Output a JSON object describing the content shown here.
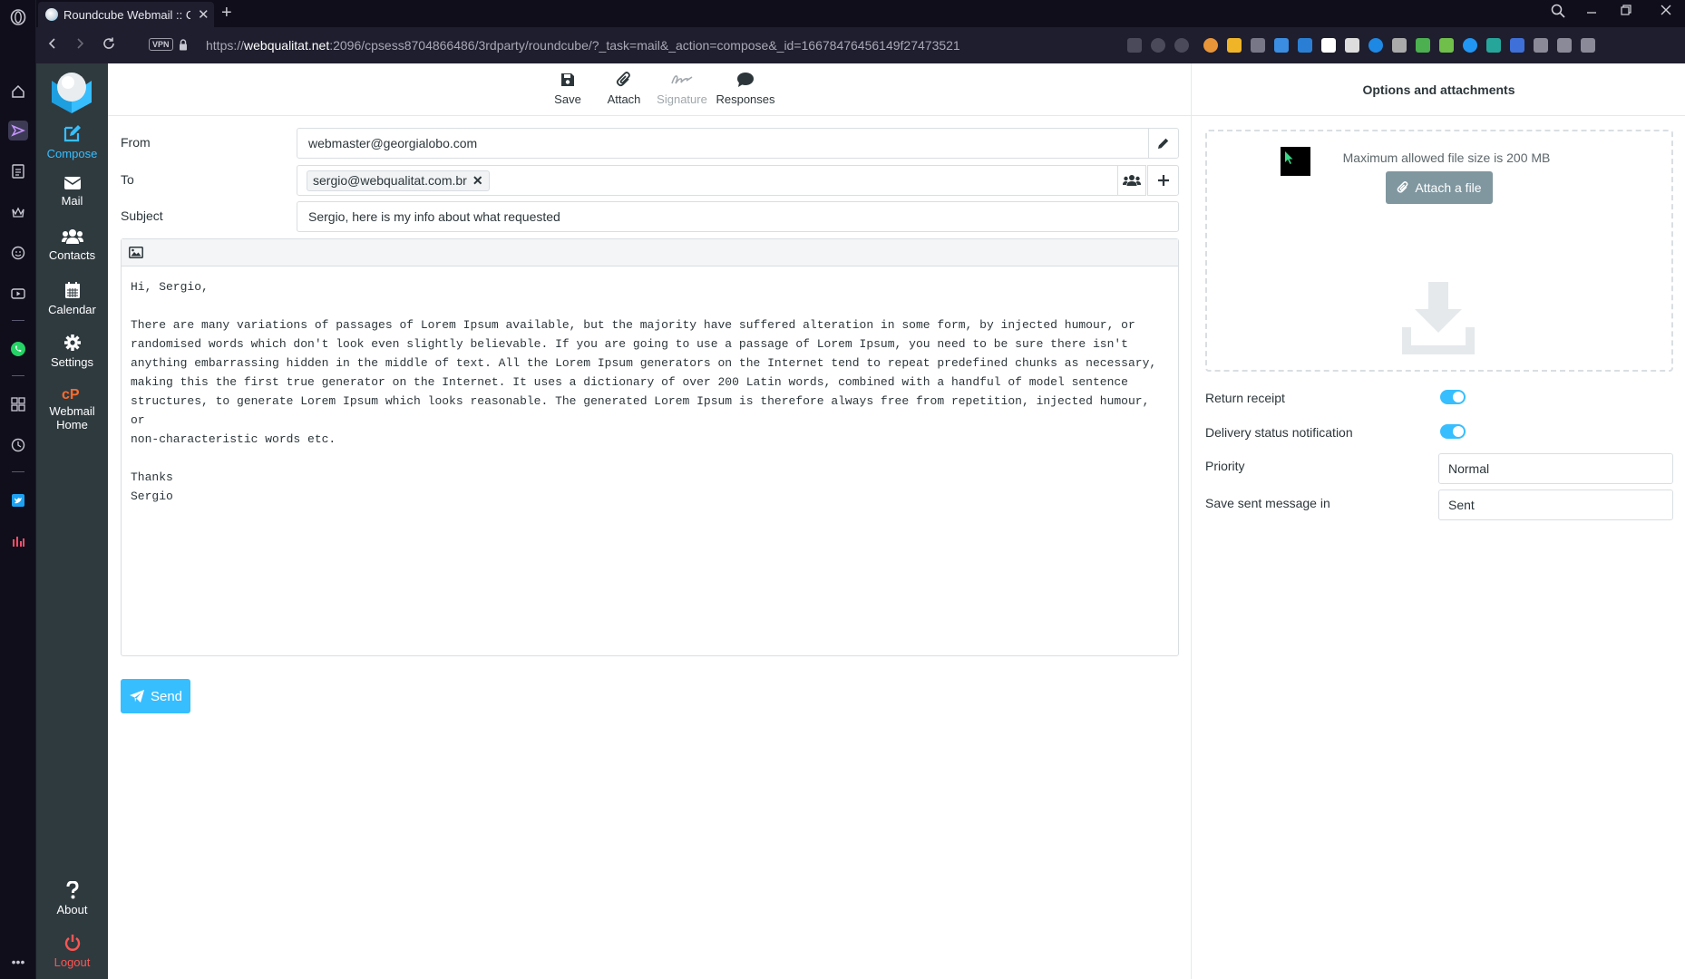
{
  "browser": {
    "tab_title": "Roundcube Webmail :: Compose",
    "tab_close": "✕",
    "new_tab": "+",
    "vpn_badge": "VPN",
    "url_prefix": "https://",
    "url_host": "webqualitat.net",
    "url_rest": ":2096/cpsess8704866486/3rdparty/roundcube/?_task=mail&_action=compose&_id=16678476456149f27473521"
  },
  "nav": {
    "compose": "Compose",
    "mail": "Mail",
    "contacts": "Contacts",
    "calendar": "Calendar",
    "settings": "Settings",
    "webmail_home_1": "Webmail",
    "webmail_home_2": "Home",
    "about": "About",
    "logout": "Logout"
  },
  "toolbar": {
    "save": "Save",
    "attach": "Attach",
    "signature": "Signature",
    "responses": "Responses"
  },
  "compose": {
    "from_label": "From",
    "from_value": "webmaster@georgialobo.com",
    "to_label": "To",
    "to_recipient": "sergio@webqualitat.com.br",
    "subject_label": "Subject",
    "subject_value": "Sergio, here is my info about what requested",
    "body": "Hi, Sergio,\n\nThere are many variations of passages of Lorem Ipsum available, but the majority have suffered alteration in some form, by injected humour, or\nrandomised words which don't look even slightly believable. If you are going to use a passage of Lorem Ipsum, you need to be sure there isn't\nanything embarrassing hidden in the middle of text. All the Lorem Ipsum generators on the Internet tend to repeat predefined chunks as necessary,\nmaking this the first true generator on the Internet. It uses a dictionary of over 200 Latin words, combined with a handful of model sentence\nstructures, to generate Lorem Ipsum which looks reasonable. The generated Lorem Ipsum is therefore always free from repetition, injected humour, or\nnon-characteristic words etc.\n\nThanks\nSergio",
    "send": "Send"
  },
  "options": {
    "title": "Options and attachments",
    "max_size": "Maximum allowed file size is 200 MB",
    "attach_file": "Attach a file",
    "return_receipt": "Return receipt",
    "return_receipt_on": true,
    "dsn": "Delivery status notification",
    "dsn_on": true,
    "priority_label": "Priority",
    "priority_value": "Normal",
    "save_sent_label": "Save sent message in",
    "save_sent_value": "Sent"
  },
  "colors": {
    "accent": "#37beff",
    "nav_bg": "#2f3a3f",
    "logout": "#ff5552",
    "browser_bg": "#0f0e1a"
  }
}
